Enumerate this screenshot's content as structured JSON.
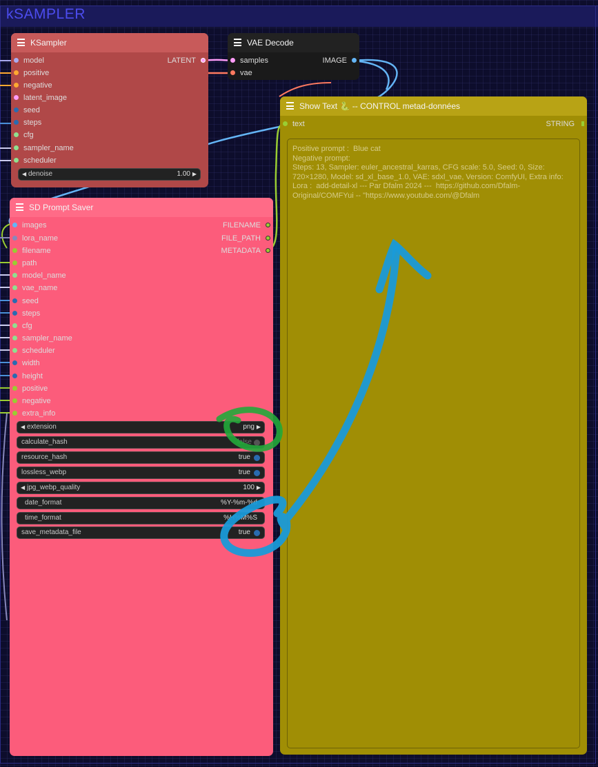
{
  "group": {
    "title": "kSAMPLER"
  },
  "ksampler": {
    "title": "KSampler",
    "inputs": [
      "model",
      "positive",
      "negative",
      "latent_image",
      "seed",
      "steps",
      "cfg",
      "sampler_name",
      "scheduler"
    ],
    "output": "LATENT",
    "widget": {
      "label": "denoise",
      "value": "1.00"
    }
  },
  "vae_decode": {
    "title": "VAE Decode",
    "inputs": [
      "samples",
      "vae"
    ],
    "output": "IMAGE"
  },
  "show_text": {
    "title": "Show Text 🐍 -- CONTROL metad-données",
    "input": "text",
    "output": "STRING",
    "content": "Positive prompt :  Blue cat\nNegative prompt:\nSteps: 13, Sampler: euler_ancestral_karras, CFG scale: 5.0, Seed: 0, Size: 720×1280, Model: sd_xl_base_1.0, VAE: sdxl_vae, Version: ComfyUI, Extra info: Lora :  add-detail-xl --- Par Dfalm 2024 ---  https://github.com/Dfalm-Original/COMFYui -- \"https://www.youtube.com/@Dfalm"
  },
  "sd_prompt_saver": {
    "title": "SD Prompt Saver",
    "inputs": [
      "images",
      "lora_name",
      "filename",
      "path",
      "model_name",
      "vae_name",
      "seed",
      "steps",
      "cfg",
      "sampler_name",
      "scheduler",
      "width",
      "height",
      "positive",
      "negative",
      "extra_info"
    ],
    "outputs": [
      "FILENAME",
      "FILE_PATH",
      "METADATA"
    ],
    "widgets": [
      {
        "label": "extension",
        "value": "png"
      },
      {
        "label": "calculate_hash",
        "value": "false"
      },
      {
        "label": "resource_hash",
        "value": "true"
      },
      {
        "label": "lossless_webp",
        "value": "true"
      },
      {
        "label": "jpg_webp_quality",
        "value": "100"
      },
      {
        "label": "date_format",
        "value": "%Y-%m-%d"
      },
      {
        "label": "time_format",
        "value": "%H%M%S"
      },
      {
        "label": "save_metadata_file",
        "value": "true"
      }
    ]
  },
  "colors": {
    "ksampler_body": "#b04848",
    "ksampler_header": "#c85a5a",
    "vae_body": "#1a1a1a",
    "saver_body": "#fc5c7b",
    "saver_header": "#ff6b87",
    "showtext_body": "#a08e05",
    "showtext_header": "#b8a315",
    "wire_image": "#64b5f6",
    "wire_latent": "#ff9cf9",
    "wire_string": "#9acd32",
    "scribble_green": "#22a83a",
    "scribble_blue": "#1a9ad8"
  }
}
